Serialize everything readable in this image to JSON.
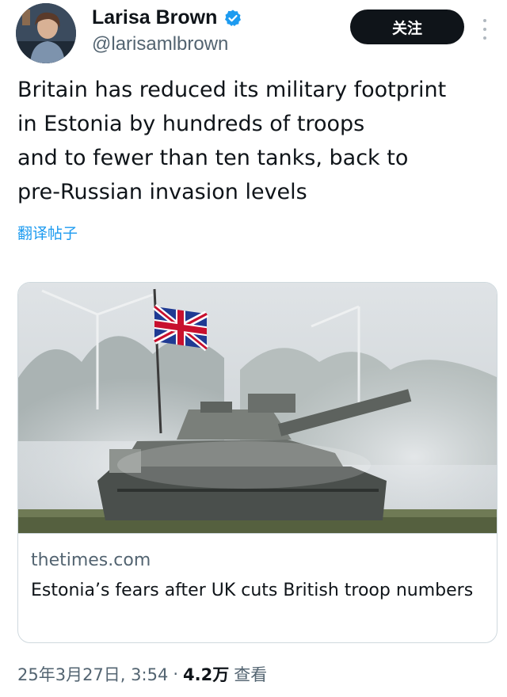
{
  "author": {
    "name": "Larisa Brown",
    "handle": "@larisamlbrown",
    "verified_icon": "verified-badge-icon",
    "avatar_icon": "profile-avatar"
  },
  "follow_label": "关注",
  "tweet": {
    "lines": [
      "Britain has reduced its military footprint",
      "in Estonia by hundreds of troops",
      "and to fewer than ten tanks, back to",
      "pre-Russian invasion levels"
    ],
    "translate_label": "翻译帖子"
  },
  "card": {
    "domain": "thetimes.com",
    "title": "Estonia’s fears after UK cuts British troop numbers",
    "image_description_icon": "tank-with-union-flag-image"
  },
  "meta": {
    "date": "25年3月27日, 3:54",
    "separator": "·",
    "views_count": "4.2万",
    "views_label": "查看"
  },
  "colors": {
    "accent": "#1d9bf0",
    "text": "#0f1419",
    "secondary": "#536471",
    "border": "#cfd9de",
    "button_bg": "#0f1419"
  }
}
